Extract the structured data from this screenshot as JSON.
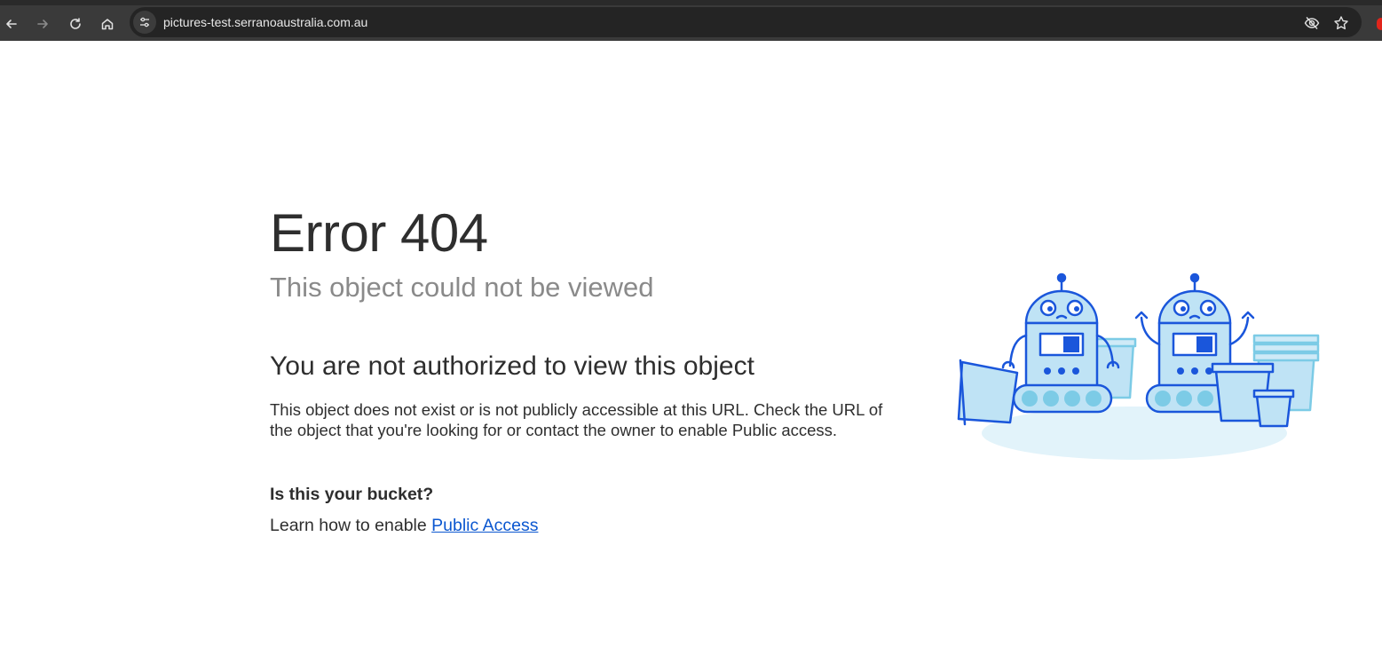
{
  "browser": {
    "url": "pictures-test.serranoaustralia.com.au",
    "nav_icons": [
      "back-arrow-icon",
      "forward-arrow-icon",
      "reload-icon",
      "home-icon"
    ],
    "site_info_icon": "site-settings-icon",
    "omnibox_icons": [
      "eye-off-icon",
      "star-icon"
    ]
  },
  "page": {
    "title": "Error 404",
    "subtitle": "This object could not be viewed",
    "heading": "You are not authorized to view this object",
    "body": "This object does not exist or is not publicly accessible at this URL. Check the URL of the object that you're looking for or contact the owner to enable Public access.",
    "question": "Is this your bucket?",
    "learn_prefix": "Learn how to enable ",
    "link_label": "Public Access"
  },
  "colors": {
    "link": "#0b57d0",
    "robot_stroke": "#1a56db",
    "robot_fill": "#bfe3f5",
    "floor": "#e2f3fa"
  }
}
